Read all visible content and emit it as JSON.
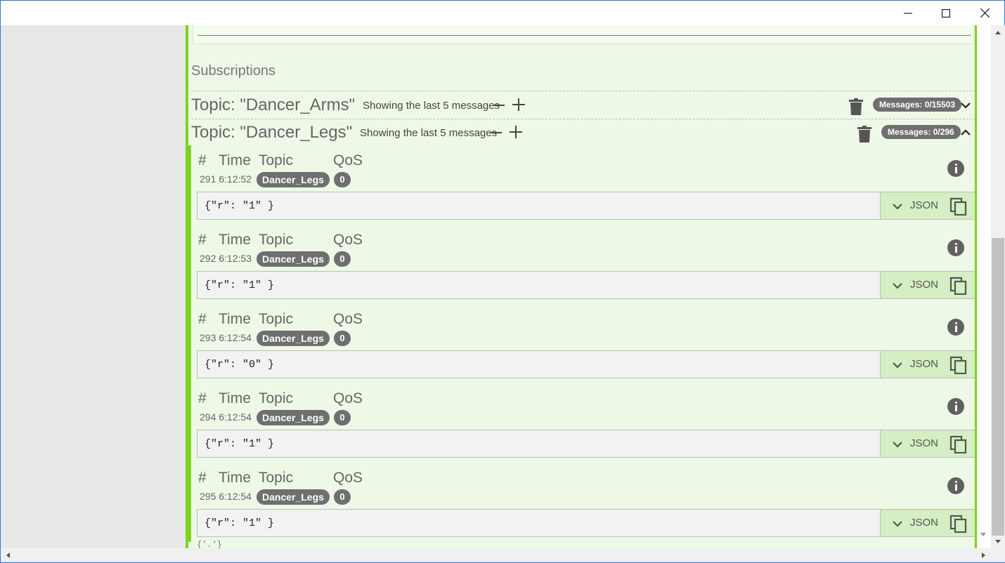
{
  "window": {
    "minimize_icon": "minimize-icon",
    "maximize_icon": "maximize-icon",
    "close_icon": "close-icon"
  },
  "subscriptions": {
    "title": "Subscriptions",
    "topics": [
      {
        "name": "Topic: \"Dancer_Arms\"",
        "showing": "Showing the last 5 messages",
        "messages_badge": "Messages: 0/15503",
        "expanded": false
      },
      {
        "name": "Topic: \"Dancer_Legs\"",
        "showing": "Showing the last 5 messages",
        "messages_badge": "Messages: 0/296",
        "expanded": true
      }
    ]
  },
  "message_header": {
    "hash": "#",
    "time": "Time",
    "topic": "Topic",
    "qos": "QoS"
  },
  "messages": [
    {
      "meta": "291 6:12:52",
      "topic": "Dancer_Legs",
      "qos": "0",
      "payload": "{\"r\": \"1\" }",
      "format": "JSON"
    },
    {
      "meta": "292 6:12:53",
      "topic": "Dancer_Legs",
      "qos": "0",
      "payload": "{\"r\": \"1\" }",
      "format": "JSON"
    },
    {
      "meta": "293 6:12:54",
      "topic": "Dancer_Legs",
      "qos": "0",
      "payload": "{\"r\": \"0\" }",
      "format": "JSON"
    },
    {
      "meta": "294 6:12:54",
      "topic": "Dancer_Legs",
      "qos": "0",
      "payload": "{\"r\": \"1\" }",
      "format": "JSON"
    },
    {
      "meta": "295 6:12:54",
      "topic": "Dancer_Legs",
      "qos": "0",
      "payload": "{\"r\": \"1\" }",
      "format": "JSON"
    }
  ],
  "clipped_text": "{'.'}",
  "colors": {
    "accent_green": "#7ed321",
    "panel_bg": "#eef8e7",
    "badge_gray": "#6f6f6f"
  }
}
